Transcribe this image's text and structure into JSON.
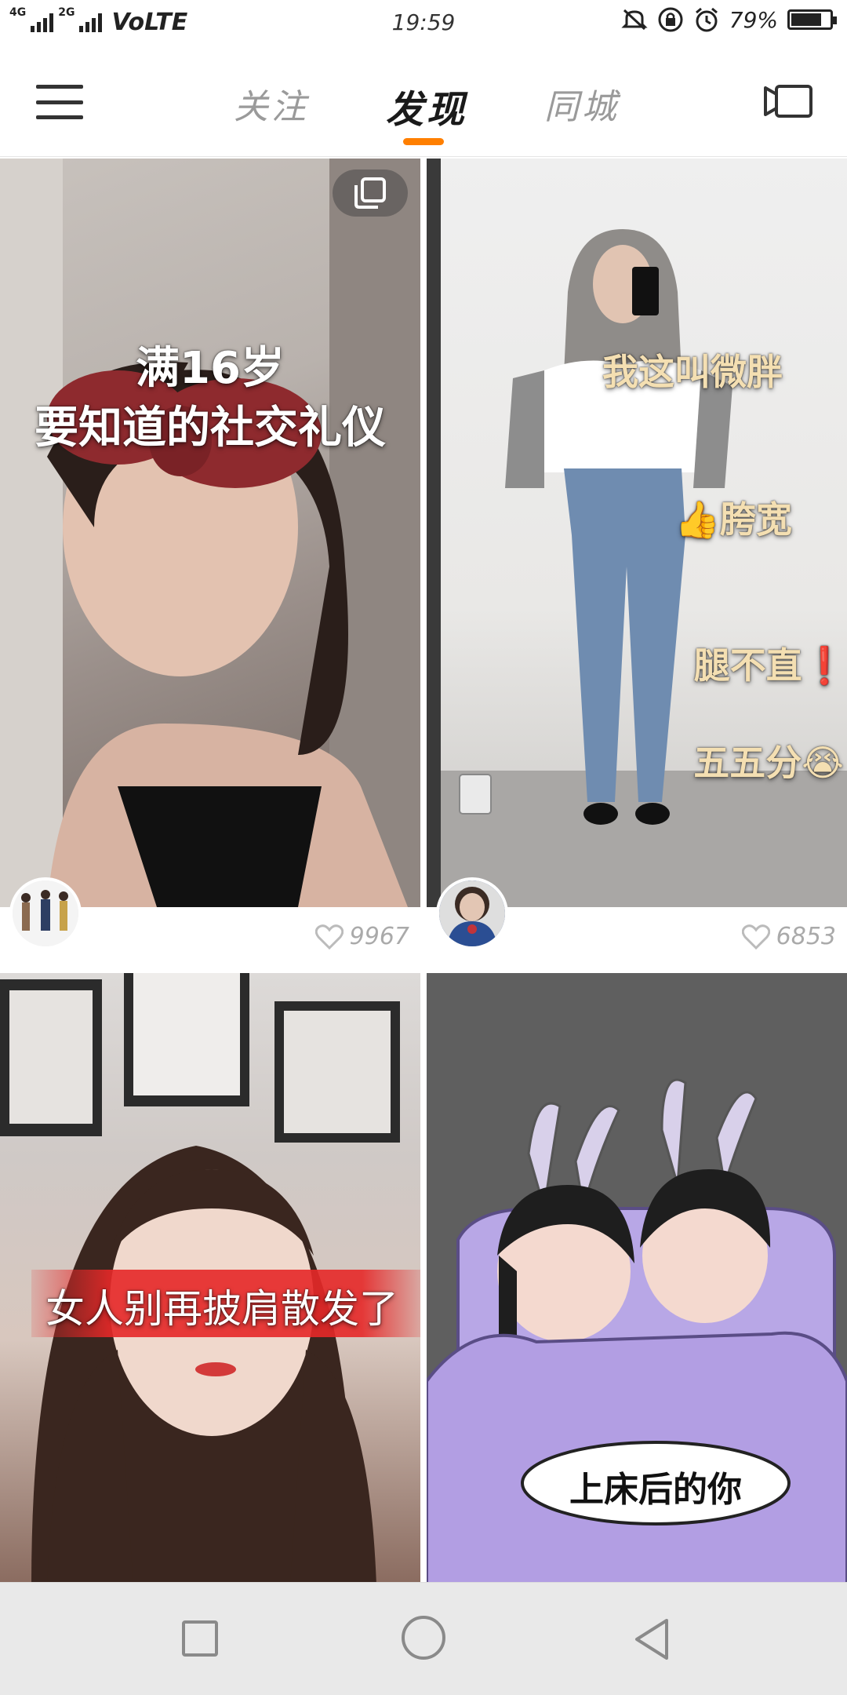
{
  "status_bar": {
    "network_left": "4G",
    "network_right": "2G",
    "volte": "VoLTE",
    "time": "19:59",
    "battery_percent": "79%",
    "battery_level": 0.79,
    "icons": [
      "mute-icon",
      "rotation-lock-icon",
      "alarm-icon",
      "battery-icon"
    ]
  },
  "nav": {
    "tabs": [
      {
        "label": "关注",
        "active": false
      },
      {
        "label": "发现",
        "active": true
      },
      {
        "label": "同城",
        "active": false
      }
    ],
    "accent_color": "#ff7f00"
  },
  "feed": {
    "cards": [
      {
        "overlay_lines": [
          "满16岁",
          "要知道的社交礼仪"
        ],
        "likes": "9967",
        "multi_image": true
      },
      {
        "overlay_lines": [
          "我这叫微胖",
          "👍胯宽",
          "腿不直❗",
          "五五分😭"
        ],
        "likes": "6853",
        "multi_image": false
      },
      {
        "overlay_lines": [
          "女人别再披肩散发了"
        ]
      },
      {
        "overlay_lines": [
          "上床后的你"
        ]
      }
    ]
  },
  "system_nav": {
    "buttons": [
      "recent-apps",
      "home",
      "back"
    ]
  }
}
